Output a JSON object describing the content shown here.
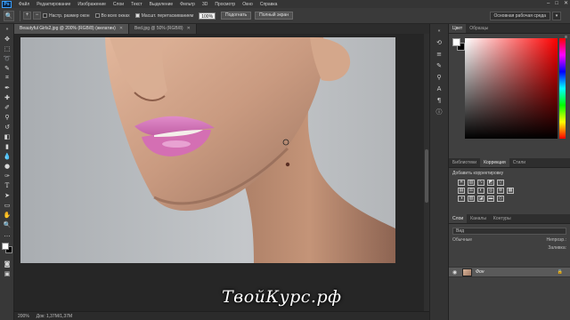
{
  "app": {
    "logo": "Ps"
  },
  "menu": [
    "Файл",
    "Редактирование",
    "Изображение",
    "Слои",
    "Текст",
    "Выделение",
    "Фильтр",
    "3D",
    "Просмотр",
    "Окно",
    "Справка"
  ],
  "window_controls": [
    "–",
    "□",
    "✕"
  ],
  "options_bar": {
    "resize_windows_label": "Настр. размер окон",
    "all_windows_label": "Во всех окнах",
    "scrubby_zoom_label": "Масшт. перетаскиванием",
    "zoom_value": "100%",
    "fit_screen_button": "Подогнать",
    "fill_screen_button": "Полный экран",
    "workspace": "Основная рабочая среда"
  },
  "documents": [
    {
      "title": "Beautyful Girls2.jpg @ 200% (RGB/8) (желатин)",
      "active": true
    },
    {
      "title": "Bed.jpg @ 50% (RGB/8)",
      "active": false
    }
  ],
  "statusbar": {
    "zoom": "200%",
    "doc_size": "Док: 1,37M/1,37M",
    "play": "▶"
  },
  "watermark": "ТвойКурс.рф",
  "color_panel": {
    "tabs": [
      "Цвет",
      "Образцы"
    ],
    "fg": "#ffffff",
    "bg": "#000000"
  },
  "adjustments_panel": {
    "tabs": [
      "Библиотеки",
      "Коррекция",
      "Стили"
    ],
    "title": "Добавить корректировку"
  },
  "layers_panel": {
    "tabs": [
      "Слои",
      "Каналы",
      "Контуры"
    ],
    "filter_label": "Вид",
    "blend_mode": "Обычные",
    "opacity_label": "Непрозр.:",
    "fill_label": "Заливка:",
    "layers": [
      {
        "name": "Фон",
        "visible": true,
        "locked": true
      }
    ]
  },
  "colors": {
    "accent": "#3aa0ff",
    "lip": "#d87bbd",
    "skin": "#c99a80"
  }
}
